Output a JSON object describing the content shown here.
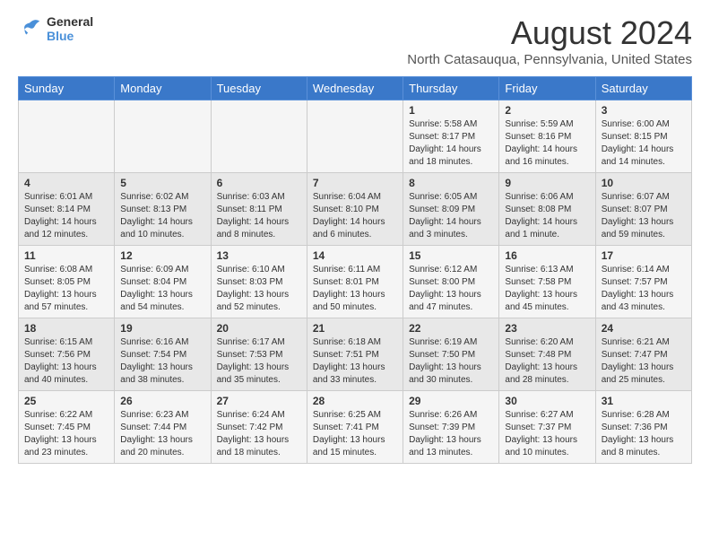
{
  "header": {
    "logo_line1": "General",
    "logo_line2": "Blue",
    "month": "August 2024",
    "location": "North Catasauqua, Pennsylvania, United States"
  },
  "weekdays": [
    "Sunday",
    "Monday",
    "Tuesday",
    "Wednesday",
    "Thursday",
    "Friday",
    "Saturday"
  ],
  "weeks": [
    [
      {
        "day": "",
        "info": ""
      },
      {
        "day": "",
        "info": ""
      },
      {
        "day": "",
        "info": ""
      },
      {
        "day": "",
        "info": ""
      },
      {
        "day": "1",
        "info": "Sunrise: 5:58 AM\nSunset: 8:17 PM\nDaylight: 14 hours\nand 18 minutes."
      },
      {
        "day": "2",
        "info": "Sunrise: 5:59 AM\nSunset: 8:16 PM\nDaylight: 14 hours\nand 16 minutes."
      },
      {
        "day": "3",
        "info": "Sunrise: 6:00 AM\nSunset: 8:15 PM\nDaylight: 14 hours\nand 14 minutes."
      }
    ],
    [
      {
        "day": "4",
        "info": "Sunrise: 6:01 AM\nSunset: 8:14 PM\nDaylight: 14 hours\nand 12 minutes."
      },
      {
        "day": "5",
        "info": "Sunrise: 6:02 AM\nSunset: 8:13 PM\nDaylight: 14 hours\nand 10 minutes."
      },
      {
        "day": "6",
        "info": "Sunrise: 6:03 AM\nSunset: 8:11 PM\nDaylight: 14 hours\nand 8 minutes."
      },
      {
        "day": "7",
        "info": "Sunrise: 6:04 AM\nSunset: 8:10 PM\nDaylight: 14 hours\nand 6 minutes."
      },
      {
        "day": "8",
        "info": "Sunrise: 6:05 AM\nSunset: 8:09 PM\nDaylight: 14 hours\nand 3 minutes."
      },
      {
        "day": "9",
        "info": "Sunrise: 6:06 AM\nSunset: 8:08 PM\nDaylight: 14 hours\nand 1 minute."
      },
      {
        "day": "10",
        "info": "Sunrise: 6:07 AM\nSunset: 8:07 PM\nDaylight: 13 hours\nand 59 minutes."
      }
    ],
    [
      {
        "day": "11",
        "info": "Sunrise: 6:08 AM\nSunset: 8:05 PM\nDaylight: 13 hours\nand 57 minutes."
      },
      {
        "day": "12",
        "info": "Sunrise: 6:09 AM\nSunset: 8:04 PM\nDaylight: 13 hours\nand 54 minutes."
      },
      {
        "day": "13",
        "info": "Sunrise: 6:10 AM\nSunset: 8:03 PM\nDaylight: 13 hours\nand 52 minutes."
      },
      {
        "day": "14",
        "info": "Sunrise: 6:11 AM\nSunset: 8:01 PM\nDaylight: 13 hours\nand 50 minutes."
      },
      {
        "day": "15",
        "info": "Sunrise: 6:12 AM\nSunset: 8:00 PM\nDaylight: 13 hours\nand 47 minutes."
      },
      {
        "day": "16",
        "info": "Sunrise: 6:13 AM\nSunset: 7:58 PM\nDaylight: 13 hours\nand 45 minutes."
      },
      {
        "day": "17",
        "info": "Sunrise: 6:14 AM\nSunset: 7:57 PM\nDaylight: 13 hours\nand 43 minutes."
      }
    ],
    [
      {
        "day": "18",
        "info": "Sunrise: 6:15 AM\nSunset: 7:56 PM\nDaylight: 13 hours\nand 40 minutes."
      },
      {
        "day": "19",
        "info": "Sunrise: 6:16 AM\nSunset: 7:54 PM\nDaylight: 13 hours\nand 38 minutes."
      },
      {
        "day": "20",
        "info": "Sunrise: 6:17 AM\nSunset: 7:53 PM\nDaylight: 13 hours\nand 35 minutes."
      },
      {
        "day": "21",
        "info": "Sunrise: 6:18 AM\nSunset: 7:51 PM\nDaylight: 13 hours\nand 33 minutes."
      },
      {
        "day": "22",
        "info": "Sunrise: 6:19 AM\nSunset: 7:50 PM\nDaylight: 13 hours\nand 30 minutes."
      },
      {
        "day": "23",
        "info": "Sunrise: 6:20 AM\nSunset: 7:48 PM\nDaylight: 13 hours\nand 28 minutes."
      },
      {
        "day": "24",
        "info": "Sunrise: 6:21 AM\nSunset: 7:47 PM\nDaylight: 13 hours\nand 25 minutes."
      }
    ],
    [
      {
        "day": "25",
        "info": "Sunrise: 6:22 AM\nSunset: 7:45 PM\nDaylight: 13 hours\nand 23 minutes."
      },
      {
        "day": "26",
        "info": "Sunrise: 6:23 AM\nSunset: 7:44 PM\nDaylight: 13 hours\nand 20 minutes."
      },
      {
        "day": "27",
        "info": "Sunrise: 6:24 AM\nSunset: 7:42 PM\nDaylight: 13 hours\nand 18 minutes."
      },
      {
        "day": "28",
        "info": "Sunrise: 6:25 AM\nSunset: 7:41 PM\nDaylight: 13 hours\nand 15 minutes."
      },
      {
        "day": "29",
        "info": "Sunrise: 6:26 AM\nSunset: 7:39 PM\nDaylight: 13 hours\nand 13 minutes."
      },
      {
        "day": "30",
        "info": "Sunrise: 6:27 AM\nSunset: 7:37 PM\nDaylight: 13 hours\nand 10 minutes."
      },
      {
        "day": "31",
        "info": "Sunrise: 6:28 AM\nSunset: 7:36 PM\nDaylight: 13 hours\nand 8 minutes."
      }
    ]
  ]
}
